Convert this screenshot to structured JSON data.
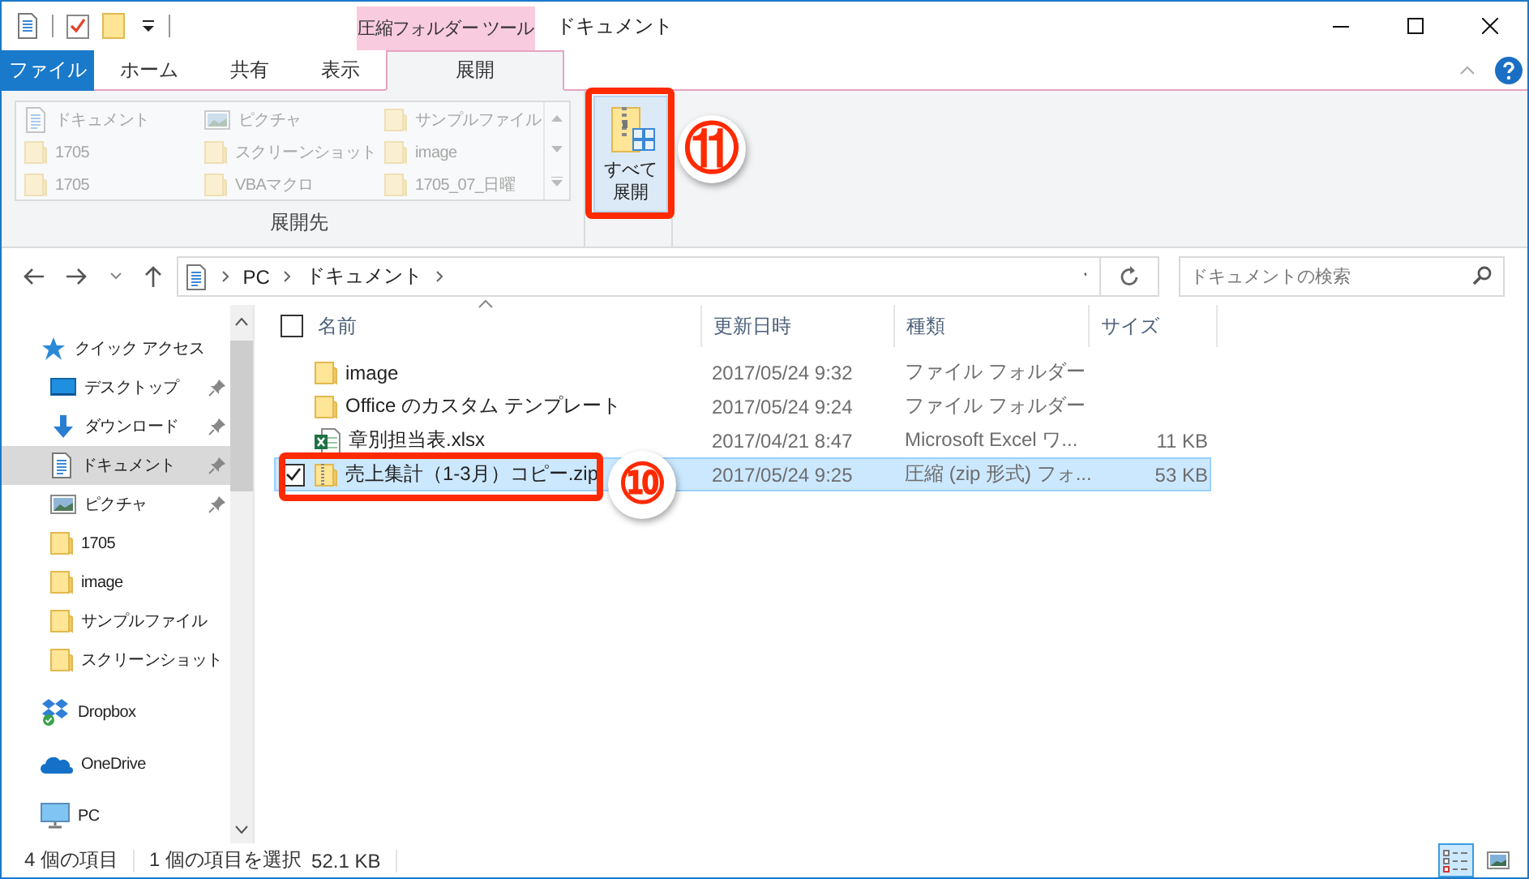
{
  "window": {
    "title": "ドキュメント",
    "context_tab": "圧縮フォルダー ツール"
  },
  "ribbon_tabs": [
    {
      "label": "ファイル",
      "kind": "file",
      "selected": false
    },
    {
      "label": "ホーム",
      "kind": "tab",
      "selected": false
    },
    {
      "label": "共有",
      "kind": "tab",
      "selected": false
    },
    {
      "label": "表示",
      "kind": "tab",
      "selected": false
    },
    {
      "label": "展開",
      "kind": "context",
      "selected": true
    }
  ],
  "ribbon": {
    "destinations": [
      {
        "label": "ドキュメント",
        "kind": "document",
        "disabled": true
      },
      {
        "label": "ピクチャ",
        "kind": "picture",
        "disabled": true
      },
      {
        "label": "サンプルファイル",
        "kind": "folder",
        "disabled": true
      },
      {
        "label": "1705",
        "kind": "folder",
        "disabled": true
      },
      {
        "label": "スクリーンショット",
        "kind": "folder",
        "disabled": true
      },
      {
        "label": "image",
        "kind": "folder",
        "disabled": true
      },
      {
        "label": "1705",
        "kind": "folder",
        "disabled": true
      },
      {
        "label": "VBAマクロ",
        "kind": "folder",
        "disabled": true
      },
      {
        "label": "1705_07_日曜",
        "kind": "folder",
        "disabled": true
      }
    ],
    "group_label": "展開先",
    "extract_all": {
      "lines": [
        "すべて",
        "展開"
      ]
    }
  },
  "address_bar": {
    "path": [
      "PC",
      "ドキュメント"
    ]
  },
  "search": {
    "placeholder": "ドキュメントの検索"
  },
  "nav_pane": {
    "items": [
      {
        "label": "クイック アクセス",
        "kind": "star",
        "selected": false,
        "children": [
          {
            "label": "デスクトップ",
            "kind": "desktop",
            "pinned": true,
            "selected": false
          },
          {
            "label": "ダウンロード",
            "kind": "download",
            "pinned": true,
            "selected": false
          },
          {
            "label": "ドキュメント",
            "kind": "document",
            "pinned": true,
            "selected": true
          },
          {
            "label": "ピクチャ",
            "kind": "picture",
            "pinned": true,
            "selected": false
          },
          {
            "label": "1705",
            "kind": "folder",
            "pinned": false,
            "selected": false
          },
          {
            "label": "image",
            "kind": "folder",
            "pinned": false,
            "selected": false
          },
          {
            "label": "サンプルファイル",
            "kind": "folder",
            "pinned": false,
            "selected": false
          },
          {
            "label": "スクリーンショット",
            "kind": "folder",
            "pinned": false,
            "selected": false
          }
        ]
      },
      {
        "label": "Dropbox",
        "kind": "dropbox",
        "selected": false
      },
      {
        "label": "OneDrive",
        "kind": "onedrive",
        "selected": false
      },
      {
        "label": "PC",
        "kind": "pc",
        "selected": false
      }
    ]
  },
  "file_list": {
    "select_all_checked": false,
    "columns": [
      "名前",
      "更新日時",
      "種類",
      "サイズ"
    ],
    "rows": [
      {
        "name": "image",
        "date": "2017/05/24 9:32",
        "type": "ファイル フォルダー",
        "kind": "folder",
        "selected": false,
        "checked": false
      },
      {
        "name": "Office のカスタム テンプレート",
        "date": "2017/05/24 9:24",
        "type": "ファイル フォルダー",
        "kind": "folder",
        "selected": false,
        "checked": false
      },
      {
        "name": "章別担当表.xlsx",
        "date": "2017/04/21 8:47",
        "type": "Microsoft Excel ワ...",
        "size": "11 KB",
        "kind": "excel",
        "selected": false,
        "checked": false
      },
      {
        "name": "売上集計（1-3月）コピー.zip",
        "date": "2017/05/24 9:25",
        "type": "圧縮 (zip 形式) フォ...",
        "size": "53 KB",
        "kind": "zip",
        "selected": true,
        "checked": true
      }
    ]
  },
  "status_bar": {
    "item_count": "4 個の項目",
    "selection": "1 個の項目を選択",
    "selection_size": "52.1 KB",
    "views": [
      {
        "kind": "details",
        "selected": true
      },
      {
        "kind": "thumbnails",
        "selected": false
      }
    ]
  },
  "annotations": [
    {
      "label": "⑪"
    },
    {
      "label": "⑩"
    }
  ]
}
